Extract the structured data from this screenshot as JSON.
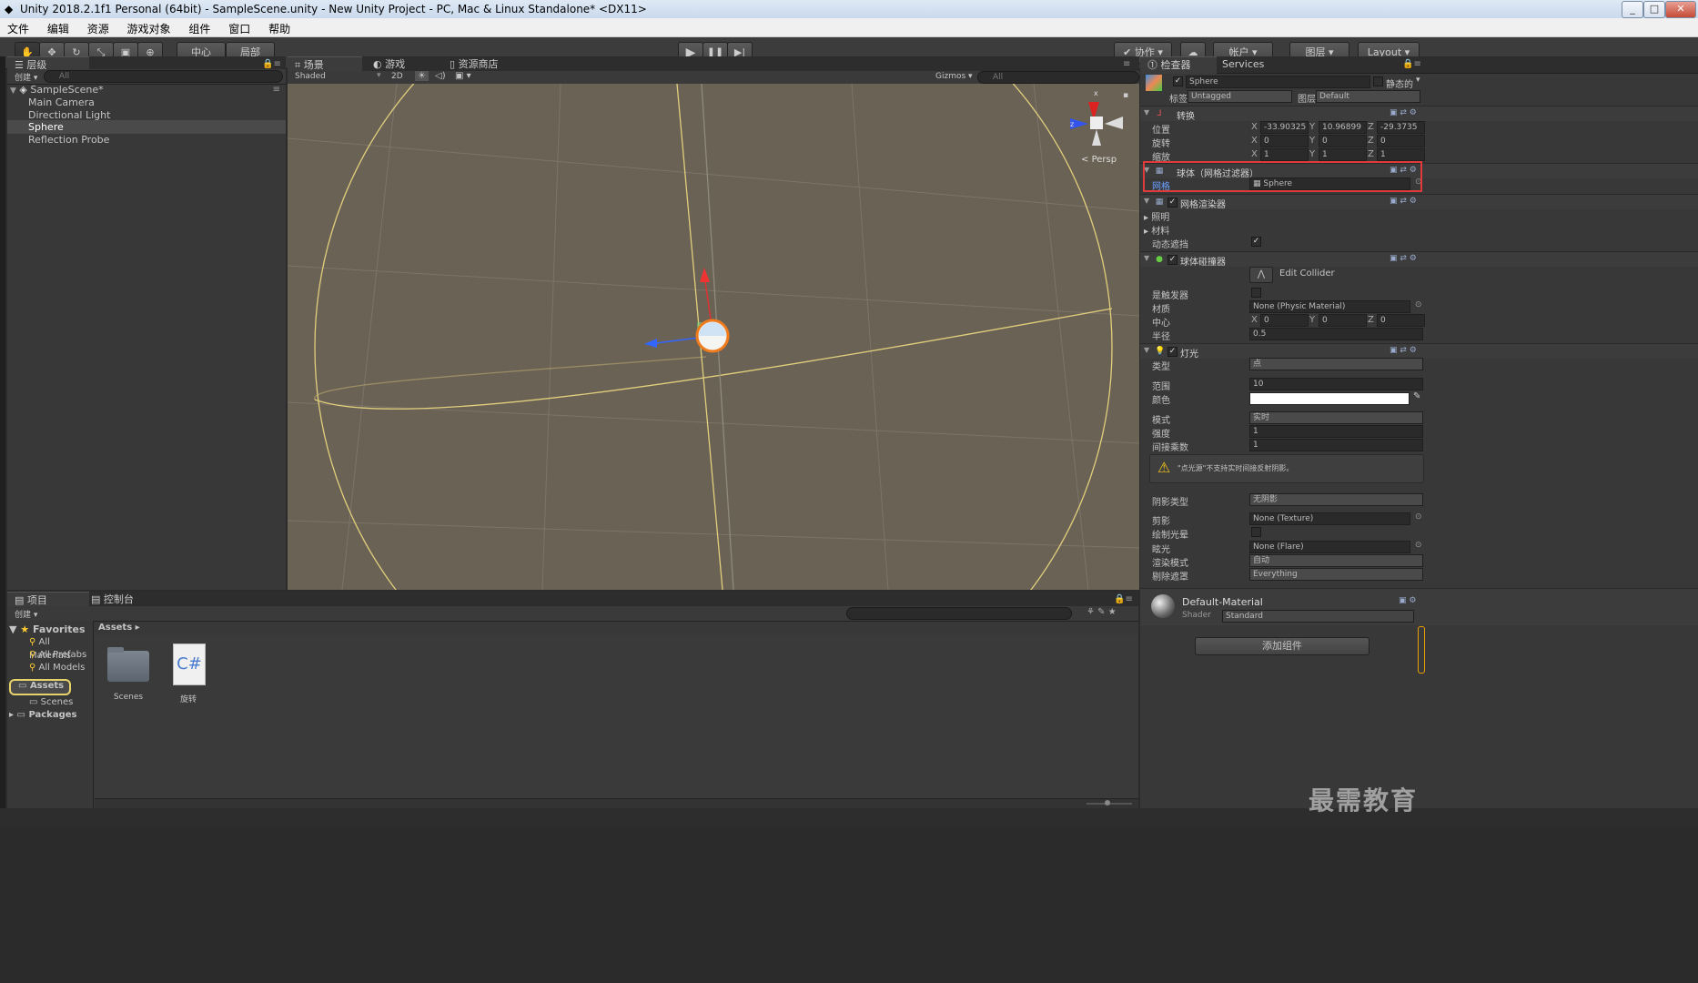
{
  "window": {
    "title": "Unity 2018.2.1f1 Personal (64bit) - SampleScene.unity - New Unity Project - PC, Mac & Linux Standalone* <DX11>"
  },
  "menu": [
    "文件",
    "编辑",
    "资源",
    "游戏对象",
    "组件",
    "窗口",
    "帮助"
  ],
  "toolbar": {
    "pivot": "中心",
    "space": "局部",
    "collab": "协作",
    "account": "帐户",
    "layers": "图层",
    "layout": "Layout"
  },
  "hierarchy": {
    "tab": "层级",
    "create": "创建",
    "search_placeholder": "All",
    "scene": "SampleScene*",
    "items": [
      "Main Camera",
      "Directional Light",
      "Sphere",
      "Reflection Probe"
    ]
  },
  "scene_view": {
    "tabs": [
      "场景",
      "游戏",
      "资源商店"
    ],
    "shading": "Shaded",
    "mode2d": "2D",
    "gizmos": "Gizmos",
    "search_placeholder": "All",
    "persp": "Persp",
    "axis_x": "x",
    "axis_z": "z"
  },
  "inspector": {
    "tabs": [
      "检查器",
      "Services"
    ],
    "object_name": "Sphere",
    "static_label": "静态的",
    "tag_label": "标签",
    "tag_value": "Untagged",
    "layer_label": "图层",
    "layer_value": "Default",
    "transform": {
      "title": "转换",
      "position_label": "位置",
      "rotation_label": "旋转",
      "scale_label": "缩放",
      "position": {
        "x": "-33.90325",
        "y": "10.96899",
        "z": "-29.3735"
      },
      "rotation": {
        "x": "0",
        "y": "0",
        "z": "0"
      },
      "scale": {
        "x": "1",
        "y": "1",
        "z": "1"
      }
    },
    "mesh_filter": {
      "title": "球体（网格过滤器）",
      "mesh_label": "网格",
      "mesh_value": "Sphere"
    },
    "mesh_renderer": {
      "title": "网格渲染器",
      "lighting": "照明",
      "materials": "材料",
      "dynamic_occlusion": "动态遮挡"
    },
    "sphere_collider": {
      "title": "球体碰撞器",
      "edit_collider": "Edit Collider",
      "is_trigger": "是触发器",
      "material_label": "材质",
      "material_value": "None (Physic Material)",
      "center_label": "中心",
      "center": {
        "x": "0",
        "y": "0",
        "z": "0"
      },
      "radius_label": "半径",
      "radius_value": "0.5"
    },
    "light": {
      "title": "灯光",
      "type_label": "类型",
      "type_value": "点",
      "range_label": "范围",
      "range_value": "10",
      "color_label": "颜色",
      "mode_label": "模式",
      "mode_value": "实时",
      "intensity_label": "强度",
      "intensity_value": "1",
      "indirect_label": "间接乘数",
      "indirect_value": "1",
      "warning": "\"点光源\"不支持实时间接反射阴影。",
      "shadow_type_label": "阴影类型",
      "shadow_type_value": "无阴影",
      "cookie_label": "剪影",
      "cookie_value": "None (Texture)",
      "draw_halo_label": "绘制光晕",
      "flare_label": "眩光",
      "flare_value": "None (Flare)",
      "render_mode_label": "渲染模式",
      "render_mode_value": "自动",
      "culling_mask_label": "剔除遮罩",
      "culling_mask_value": "Everything"
    },
    "material": {
      "name": "Default-Material",
      "shader_label": "Shader",
      "shader_value": "Standard"
    },
    "add_component": "添加组件"
  },
  "project": {
    "tabs": [
      "项目",
      "控制台"
    ],
    "create": "创建",
    "favorites": "Favorites",
    "favorite_items": [
      "All Materials",
      "All Prefabs",
      "All Models"
    ],
    "assets": "Assets",
    "scenes": "Scenes",
    "packages": "Packages",
    "breadcrumb": "Assets",
    "asset_items": [
      {
        "label": "Scenes",
        "icon": "folder-icon"
      },
      {
        "label": "旋转",
        "icon": "csharp-script-icon",
        "glyph": "C#"
      }
    ]
  },
  "watermark": "最需教育",
  "colors": {
    "scene_bg": "#6b6256",
    "highlight": "#e03a3a",
    "selection_yellow": "#e8d36a"
  }
}
